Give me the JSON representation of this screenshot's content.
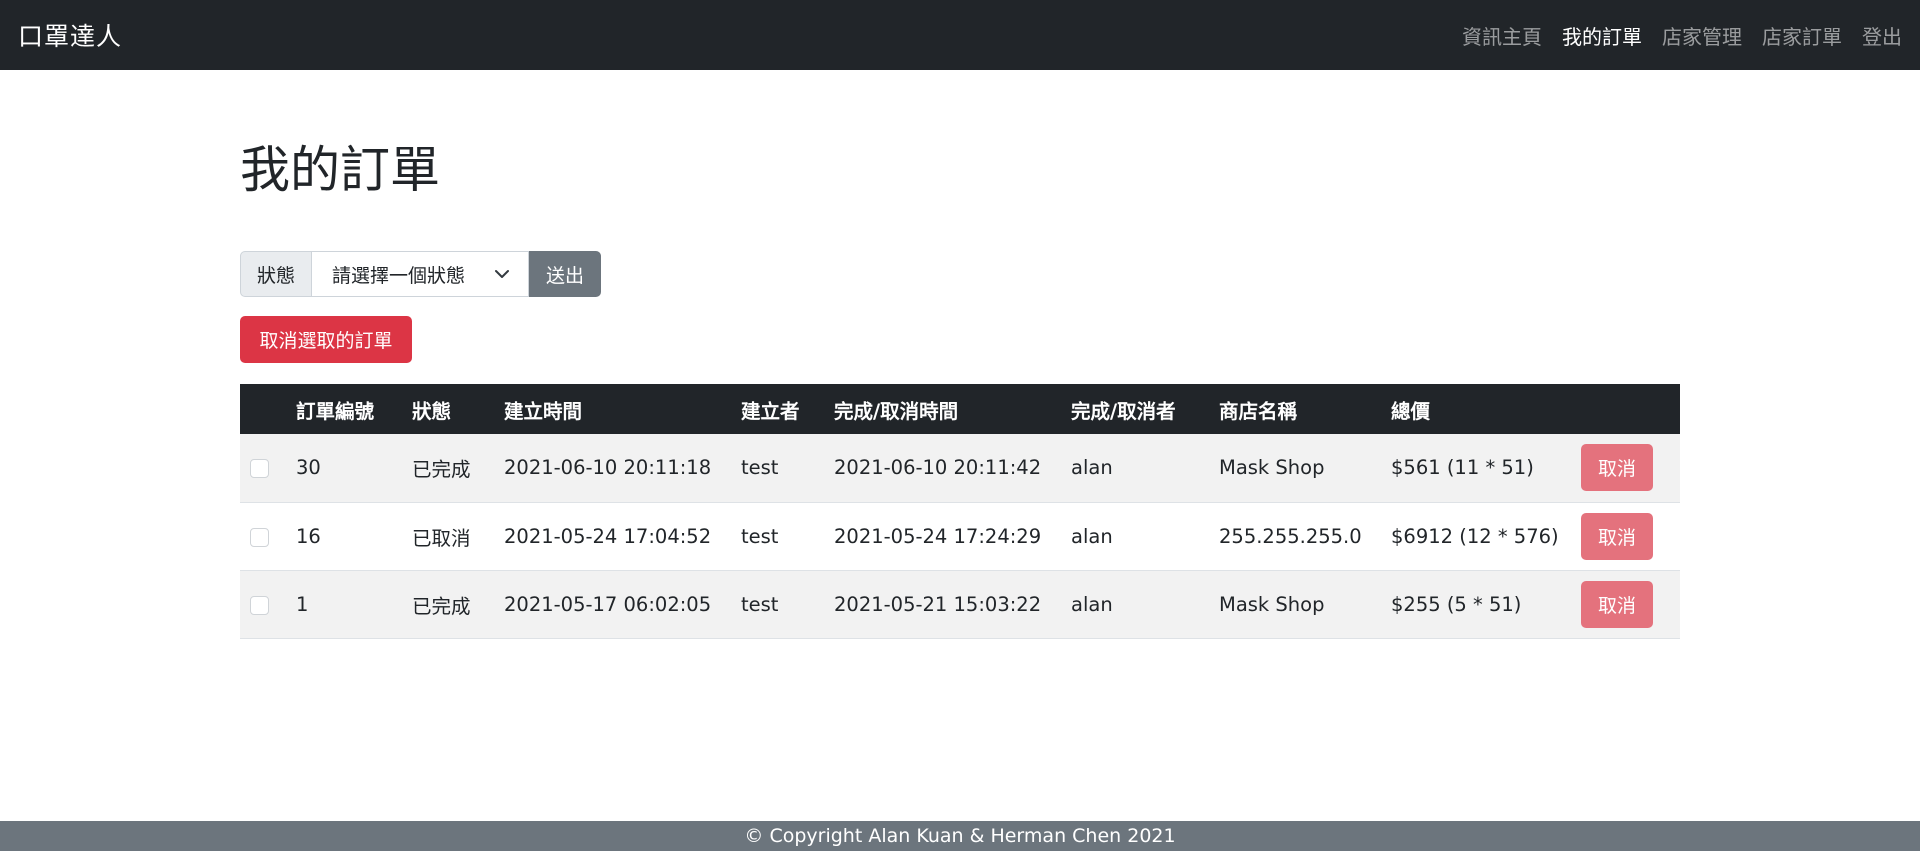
{
  "navbar": {
    "brand": "口罩達人",
    "links": [
      {
        "label": "資訊主頁"
      },
      {
        "label": "我的訂單"
      },
      {
        "label": "店家管理"
      },
      {
        "label": "店家訂單"
      },
      {
        "label": "登出"
      }
    ],
    "active_link": "我的訂單"
  },
  "page": {
    "title": "我的訂單"
  },
  "filter": {
    "label": "狀態",
    "select_value": "請選擇一個狀態",
    "submit_label": "送出"
  },
  "actions": {
    "cancel_selected_label": "取消選取的訂單"
  },
  "table": {
    "headers": [
      "",
      "訂單編號",
      "狀態",
      "建立時間",
      "建立者",
      "完成/取消時間",
      "完成/取消者",
      "商店名稱",
      "總價",
      ""
    ],
    "rows": [
      {
        "id": "30",
        "status": "已完成",
        "created": "2021-06-10 20:11:18",
        "creator": "test",
        "done_time": "2021-06-10 20:11:42",
        "done_by": "alan",
        "shop": "Mask Shop",
        "total": "$561 (11 * 51)",
        "action": "取消"
      },
      {
        "id": "16",
        "status": "已取消",
        "created": "2021-05-24 17:04:52",
        "creator": "test",
        "done_time": "2021-05-24 17:24:29",
        "done_by": "alan",
        "shop": "255.255.255.0",
        "total": "$6912 (12 * 576)",
        "action": "取消"
      },
      {
        "id": "1",
        "status": "已完成",
        "created": "2021-05-17 06:02:05",
        "creator": "test",
        "done_time": "2021-05-21 15:03:22",
        "done_by": "alan",
        "shop": "Mask Shop",
        "total": "$255 (5 * 51)",
        "action": "取消"
      }
    ]
  },
  "footer": {
    "text": "© Copyright Alan Kuan & Herman Chen 2021"
  },
  "colors": {
    "navbar_bg": "#212529",
    "danger": "#dc3545",
    "danger_disabled": "#e4727d",
    "secondary": "#6c757d"
  }
}
